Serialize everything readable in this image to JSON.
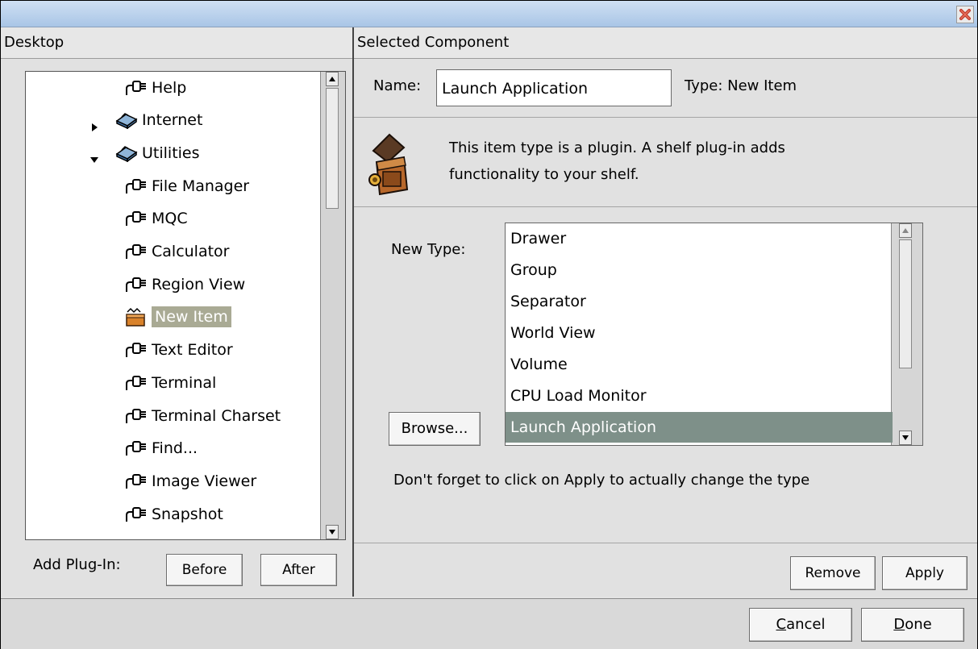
{
  "window": {
    "close_icon": "close-x-icon"
  },
  "left_panel": {
    "header": "Desktop",
    "tree": [
      {
        "label": "Help",
        "icon": "plug-icon",
        "indent": 3,
        "expander": ""
      },
      {
        "label": "Internet",
        "icon": "folder-drawer-icon",
        "indent": 2,
        "expander": "collapsed"
      },
      {
        "label": "Utilities",
        "icon": "folder-drawer-icon",
        "indent": 2,
        "expander": "expanded"
      },
      {
        "label": "File Manager",
        "icon": "plug-icon",
        "indent": 3,
        "expander": ""
      },
      {
        "label": "MQC",
        "icon": "plug-icon",
        "indent": 3,
        "expander": ""
      },
      {
        "label": "Calculator",
        "icon": "plug-icon",
        "indent": 3,
        "expander": ""
      },
      {
        "label": "Region View",
        "icon": "plug-icon",
        "indent": 3,
        "expander": ""
      },
      {
        "label": "New Item",
        "icon": "new-item-box-icon",
        "indent": 3,
        "expander": "",
        "selected": true
      },
      {
        "label": "Text Editor",
        "icon": "plug-icon",
        "indent": 3,
        "expander": ""
      },
      {
        "label": "Terminal",
        "icon": "plug-icon",
        "indent": 3,
        "expander": ""
      },
      {
        "label": "Terminal Charset",
        "icon": "plug-icon",
        "indent": 3,
        "expander": ""
      },
      {
        "label": "Find...",
        "icon": "plug-icon",
        "indent": 3,
        "expander": ""
      },
      {
        "label": "Image Viewer",
        "icon": "plug-icon",
        "indent": 3,
        "expander": ""
      },
      {
        "label": "Snapshot",
        "icon": "plug-icon",
        "indent": 3,
        "expander": ""
      }
    ],
    "add_plugin_label": "Add Plug-In:",
    "before_button": "Before",
    "after_button": "After"
  },
  "right_panel": {
    "header": "Selected Component",
    "name_label": "Name:",
    "name_value": "Launch Application",
    "type_label": "Type: New Item",
    "description_line1": "This item type is a plugin. A shelf plug-in adds",
    "description_line2": "functionality to your shelf.",
    "new_type_label": "New Type:",
    "types": [
      "Drawer",
      "Group",
      "Separator",
      "World View",
      "Volume",
      "CPU Load Monitor",
      "Launch Application"
    ],
    "selected_type": "Launch Application",
    "browse_button": "Browse...",
    "hint": "Don't forget to click on Apply to actually change the type",
    "remove_button": "Remove",
    "apply_button": "Apply"
  },
  "footer": {
    "cancel_button": {
      "mnemonic": "C",
      "rest": "ancel"
    },
    "done_button": {
      "mnemonic": "D",
      "rest": "one"
    }
  },
  "colors": {
    "selection": "#7e9089",
    "tree_selection": "#a9aa94",
    "titlebar": "#b7cfec"
  }
}
